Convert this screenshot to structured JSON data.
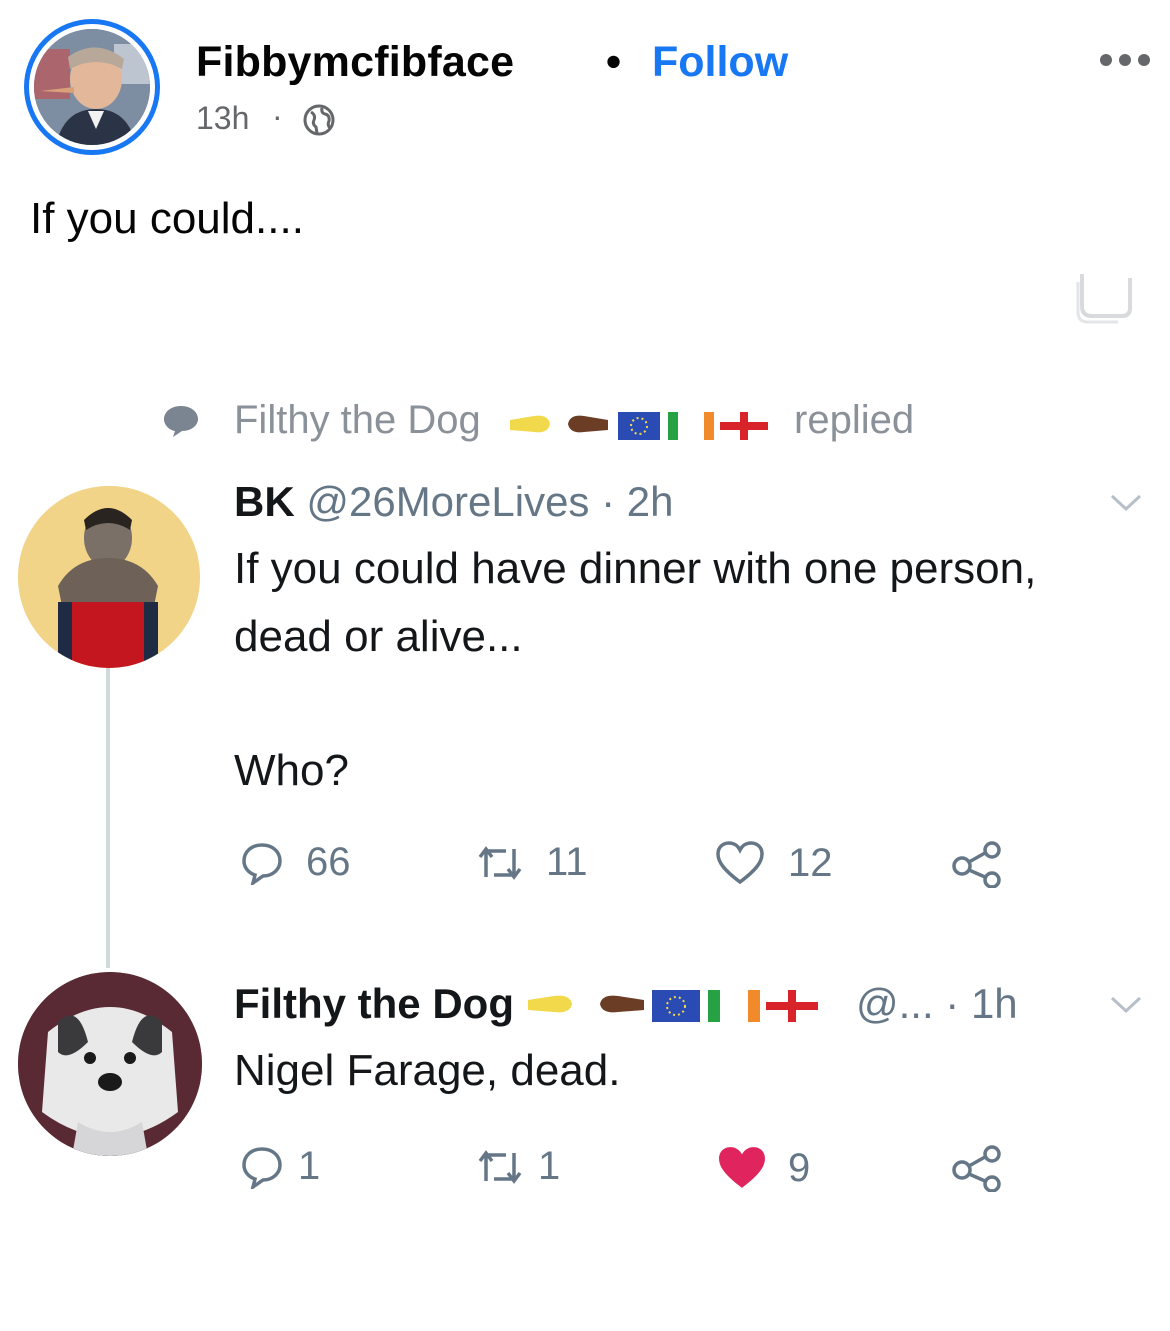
{
  "post": {
    "author": "Fibbymcfibface",
    "separator": "•",
    "follow_label": "Follow",
    "time": "13h",
    "time_sep": "·",
    "audience_icon": "globe-icon",
    "more_icon": "more-horizontal-icon",
    "text": "If you could...."
  },
  "tweet_screenshot": {
    "context": {
      "name": "Filthy the Dog",
      "action": "replied"
    },
    "original_tweet": {
      "name": "BK",
      "handle_time": "@26MoreLives · 2h",
      "line1": "If you could have dinner with one person,",
      "line2": "dead or alive...",
      "line3": "Who?",
      "replies": "66",
      "retweets": "11",
      "likes": "12"
    },
    "reply_tweet": {
      "name": "Filthy the Dog",
      "handle_time": "@... · 1h",
      "text": "Nigel Farage, dead.",
      "replies": "1",
      "retweets": "1",
      "likes": "9",
      "liked_color": "#e0245e"
    }
  },
  "colors": {
    "facebook_blue": "#1877f2",
    "muted_gray": "#657786"
  }
}
